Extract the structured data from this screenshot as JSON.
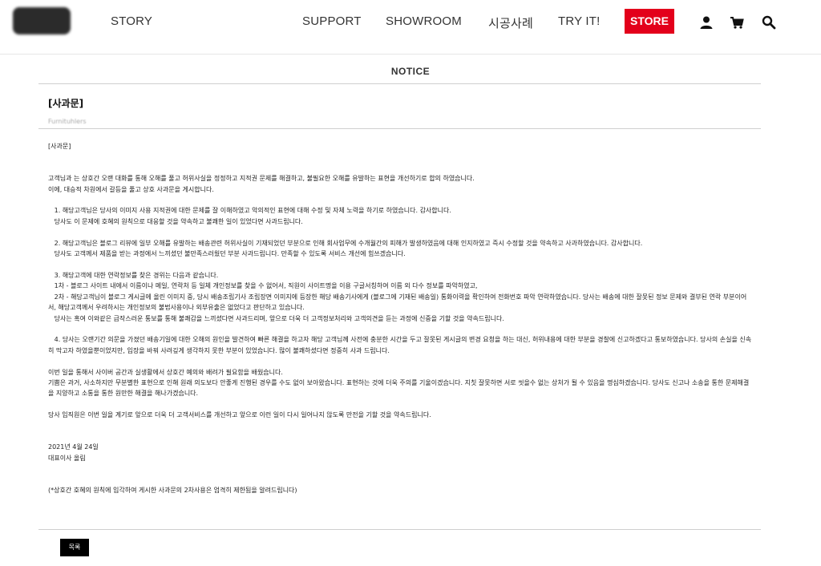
{
  "nav": {
    "story": "STORY",
    "support": "SUPPORT",
    "showroom": "SHOWROOM",
    "cases": "시공사례",
    "tryit": "TRY IT!",
    "store": "STORE"
  },
  "icons": {
    "user": "user-icon",
    "cart": "cart-icon",
    "search": "search-icon"
  },
  "colors": {
    "store_bg": "#e3001b",
    "button_bg": "#000000"
  },
  "notice": {
    "heading": "NOTICE",
    "title": "[사과문]",
    "author": "Furnituhlers",
    "body": [
      "[사과문]",
      "",
      "",
      "고객님과 는 상호간 오랜 대화를 통해 오해를 풀고 허위사실을 정정하고 지적권 문제를 해결하고, 불필요한 오해를 유발하는 표현을 개선하기로 합의 하였습니다.",
      "이에, 대승적 차원에서 갈등을 풀고 상호 사과문을 게시합니다.",
      "",
      "   1. 해당고객님은 당사의 이미지 사용 지적권에 대한 문제를 잘 이해하였고 악의적인 표현에 대해 수정 및 자체 노력을 하기로 하였습니다. 감사합니다.",
      "   당사도 이 문제에 호혜의 원칙으로 대응할 것을 약속하고 불쾌한 일이 있었다면 사과드립니다.",
      "",
      "   2. 해당고객님은 블로그 리뷰에 일부 오해를 유발하는 배송관련 허위사실이 기재되었던 부분으로 인해 회사업무에 수개월간의 피해가 발생하였음에 대해 인지하였고 즉시 수정할 것을 약속하고 사과하였습니다. 감사합니다.",
      "   당사도 고객께서 제품을 받는 과정에서 느끼셨던 불만족스러웠던 부분 사과드립니다. 만족할 수 있도록 서비스 개선에 힘쓰겠습니다.",
      "",
      "   3. 해당고객에 대한 연락정보를 찾은 경위는 다음과 같습니다.",
      "   1차 - 블로그 사이트 내에서 이름이나 메일, 연락처 등 일체 개인정보를 찾을 수 없어서, 직원이 사이트명을 이용 구글서칭하여 이름 외 다수 정보를 파악하였고,",
      "   2차 - 해당고객님이 블로그 게시글에 올린 이미지 중, 당시 배송조립기사 조립장면 이미지에 등장한 해당 배송기사에게 (블로그에 기재된 배송일) 통화이력을 확인하여 전화번호 파악 연락하였습니다. 당사는 배송에 대한 잘못된 정보 문제와 결부된 연락 부분이어서, 해당고객께서 우려하시는 개인정보의 불법사용이나 외부유출은 없었다고 판단하고 있습니다.",
      "   당사는 혹여 이와같은 급작스러운 통보를 통해 불쾌감을 느끼셨다면 사과드리며, 앞으로 더욱 더 고객정보처리와 고객의견을 듣는 과정에 신중을 기할 것을 약속드립니다.",
      "",
      "   4. 당사는 오랜기간 의문을 가졌던 배송기일에 대한 오해의 원인을 발견하여 빠른 해결을 하고자 해당 고객님께 사전에 충분한 시간을 두고 잘못된 게시글의 변경 요청을 하는 대신, 허위내용에 대한 부분을 경찰에 신고하겠다고 통보하였습니다. 당사의 손실을 신속히 막고자 하였을뿐이었지만, 입장을 바꿔 사려깊게 생각하지 못한 부분이 있었습니다. 많이 불쾌하셨다면 정중히 사과 드립니다.",
      "",
      "이번 일을 통해서 사이버 공간과 실생활에서 상호간 예의와 배려가 필요함을 배웠습니다.",
      "기쁨은 과거, 사소하지만 무분별한 표현으로 인해 원래 의도보다 안좋게 진행된 경우를 수도 없이 보아왔습니다. 표현하는 것에 더욱 주의를 기울이겠습니다. 지칫 잘못하면 서로 씻을수 없는 상처가 될 수 있음을 명심하겠습니다. 당사도 신고나 소송을 통한 문제해결을 지양하고 소통을 통한 원만한 해결을 해나가겠습니다.",
      "",
      "당사 임직원은 이번 일을 계기로 앞으로 더욱 더 고객서비스를 개선하고 앞으로 이런 일이 다시 일어나지 않도록 만전을 기할 것을 약속드립니다.",
      "",
      "",
      "2021년 4월 24일",
      "대표이사 올림",
      "",
      "",
      "(*상호간 호혜의 원칙에 입각하여 게시한 사과문의 2차사용은 엄격히 제한됨을 알려드립니다)"
    ],
    "list_button": "목록"
  }
}
